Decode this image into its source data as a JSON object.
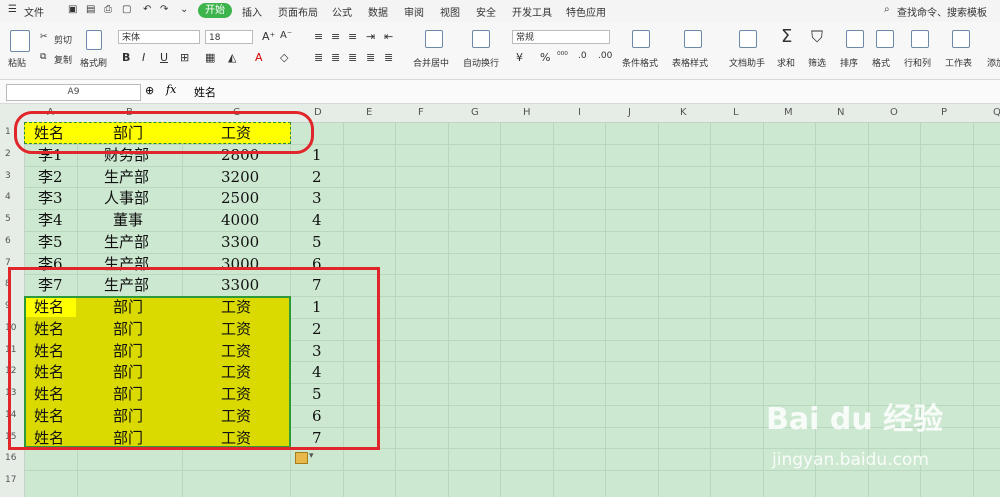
{
  "menu": {
    "file": "文件",
    "tabs": [
      "开始",
      "插入",
      "页面布局",
      "公式",
      "数据",
      "审阅",
      "视图",
      "安全",
      "开发工具",
      "特色应用"
    ],
    "search": "查找命令、搜索模板"
  },
  "ribbon": {
    "paste": "粘贴",
    "cut": "剪切",
    "copy": "复制",
    "format_painter": "格式刷",
    "font_name": "宋体",
    "font_size": "18",
    "bold": "B",
    "italic": "I",
    "underline": "U",
    "merge_center": "合并居中",
    "auto_wrap": "自动换行",
    "number_format": "常规",
    "percent": "%",
    "conditional_format": "条件格式",
    "table_style": "表格样式",
    "doc_helper": "文档助手",
    "sum": "求和",
    "filter": "筛选",
    "sort": "排序",
    "format": "格式",
    "row_col": "行和列",
    "worksheet": "工作表",
    "add": "添加"
  },
  "formula": {
    "cell_ref": "A9",
    "fx": "fx",
    "content": "姓名"
  },
  "columns": [
    "A",
    "B",
    "C",
    "D",
    "E",
    "F",
    "G",
    "H",
    "I",
    "J",
    "K",
    "L",
    "M",
    "N",
    "O",
    "P",
    "Q"
  ],
  "rows": [
    "1",
    "2",
    "3",
    "4",
    "5",
    "6",
    "7",
    "8",
    "9",
    "10",
    "11",
    "12",
    "13",
    "14",
    "15",
    "16",
    "17"
  ],
  "sheet": {
    "header": [
      "姓名",
      "部门",
      "工资"
    ],
    "data": [
      [
        "李1",
        "财务部",
        "2800",
        "1"
      ],
      [
        "李2",
        "生产部",
        "3200",
        "2"
      ],
      [
        "李3",
        "人事部",
        "2500",
        "3"
      ],
      [
        "李4",
        "董事",
        "4000",
        "4"
      ],
      [
        "李5",
        "生产部",
        "3300",
        "5"
      ],
      [
        "李6",
        "生产部",
        "3000",
        "6"
      ],
      [
        "李7",
        "生产部",
        "3300",
        "7"
      ]
    ],
    "copies": [
      [
        "姓名",
        "部门",
        "工资",
        "1"
      ],
      [
        "姓名",
        "部门",
        "工资",
        "2"
      ],
      [
        "姓名",
        "部门",
        "工资",
        "3"
      ],
      [
        "姓名",
        "部门",
        "工资",
        "4"
      ],
      [
        "姓名",
        "部门",
        "工资",
        "5"
      ],
      [
        "姓名",
        "部门",
        "工资",
        "6"
      ],
      [
        "姓名",
        "部门",
        "工资",
        "7"
      ]
    ]
  },
  "colors": {
    "highlight": "#dad900",
    "header_fill": "#ffff00",
    "annotation": "#e0262a",
    "accent": "#3cb44b"
  },
  "watermark": {
    "line1": "Bai du 经验",
    "line2": "jingyan.baidu.com"
  }
}
